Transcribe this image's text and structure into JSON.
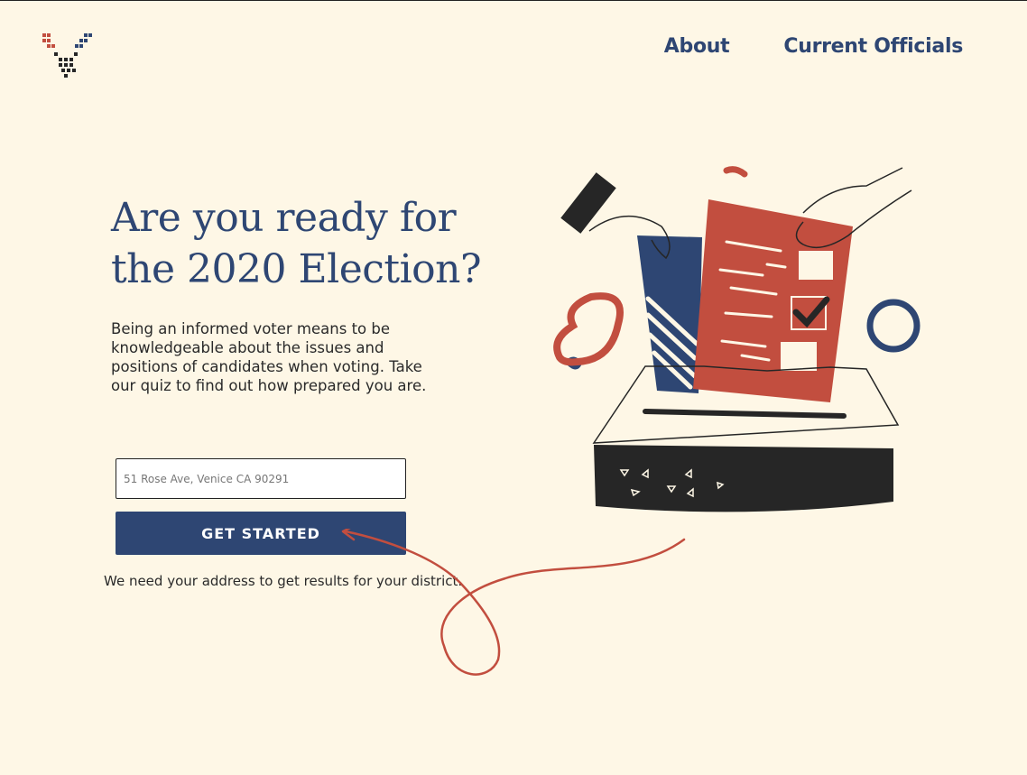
{
  "brand": {
    "logo_icon": "pixel-v-check-logo-icon"
  },
  "nav": {
    "items": [
      {
        "label": "About"
      },
      {
        "label": "Current Officials"
      }
    ]
  },
  "hero": {
    "headline": "Are you ready for the 2020 Election?",
    "body": "Being an informed voter means to be knowledgeable about the issues and positions of candidates when voting. Take our quiz to find out how prepared you are."
  },
  "form": {
    "address_placeholder": "51 Rose Ave, Venice CA 90291",
    "address_value": "",
    "submit_label": "GET STARTED",
    "note": "We need your address to get results for your district."
  },
  "illustration": {
    "icon": "ballot-box-illustration-icon"
  },
  "decoration": {
    "icon": "curly-arrow-icon"
  },
  "colors": {
    "background": "#fef7e6",
    "primary_blue": "#2e4673",
    "accent_red": "#c24e3f",
    "dark": "#262626"
  }
}
